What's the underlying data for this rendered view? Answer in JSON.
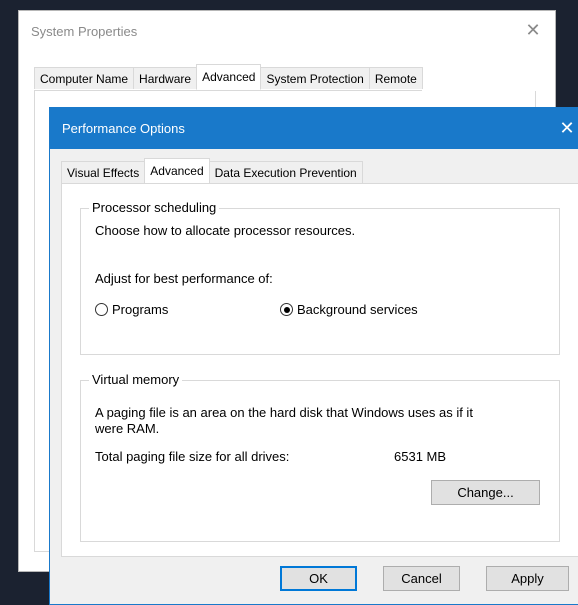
{
  "back_window": {
    "title": "System Properties",
    "close_glyph": "✕",
    "tabs": [
      "Computer Name",
      "Hardware",
      "Advanced",
      "System Protection",
      "Remote"
    ],
    "active_tab": "Advanced"
  },
  "dialog": {
    "title": "Performance Options",
    "close_glyph": "✕",
    "tabs": [
      "Visual Effects",
      "Advanced",
      "Data Execution Prevention"
    ],
    "active_tab": "Advanced",
    "processor": {
      "legend": "Processor scheduling",
      "description": "Choose how to allocate processor resources.",
      "adjust_label": "Adjust for best performance of:",
      "options": [
        {
          "label": "Programs",
          "selected": false
        },
        {
          "label": "Background services",
          "selected": true
        }
      ]
    },
    "virtual_memory": {
      "legend": "Virtual memory",
      "description_line1": "A paging file is an area on the hard disk that Windows uses as if it",
      "description_line2": "were RAM.",
      "total_label": "Total paging file size for all drives:",
      "total_value": "6531 MB",
      "change_button": "Change..."
    },
    "buttons": {
      "ok": "OK",
      "cancel": "Cancel",
      "apply": "Apply"
    }
  }
}
